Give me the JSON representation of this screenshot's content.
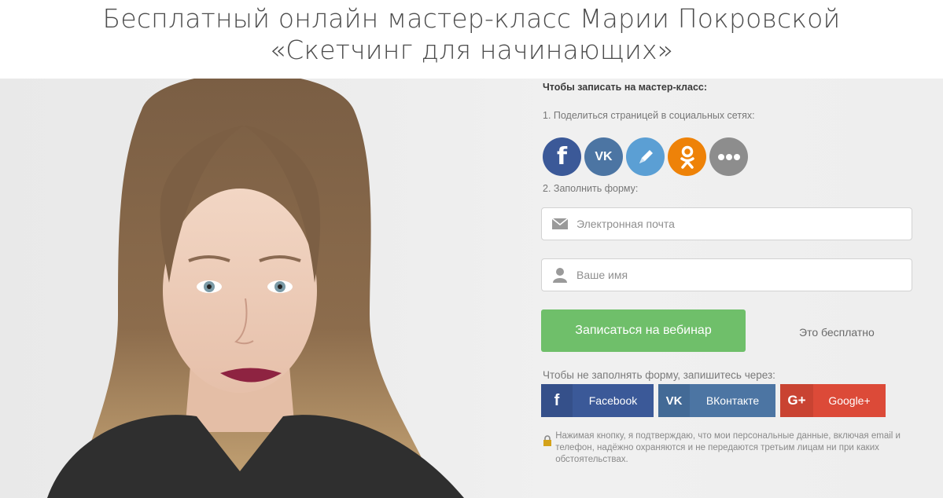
{
  "header": {
    "title_line1": "Бесплатный онлайн мастер-класс Марии Покровской",
    "title_line2": "«Скетчинг для начинающих»"
  },
  "form": {
    "heading": "Чтобы записать на мастер-класс:",
    "step1": "1. Поделиться страницей в социальных сетях:",
    "social_icons": [
      "facebook-icon",
      "vk-icon",
      "livejournal-icon",
      "odnoklassniki-icon",
      "more-icon"
    ],
    "step2": "2. Заполнить форму:",
    "email_placeholder": "Электронная почта",
    "name_placeholder": "Ваше имя",
    "submit_label": "Записаться на вебинар",
    "free_label": "Это бесплатно",
    "alt_signup_text": "Чтобы не заполнять форму, запишитесь через:",
    "facebook_label": "Facebook",
    "vk_label": "ВКонтакте",
    "google_label": "Google+",
    "privacy_text": "Нажимая кнопку, я подтверждаю, что мои персональные данные, включая email и телефон, надёжно охраняются и не передаются третьим лицам ни при каких обстоятельствах."
  },
  "colors": {
    "submit": "#6fbf6a",
    "facebook": "#3b5998",
    "vk": "#4c75a3",
    "google": "#dc4a38",
    "odnoklassniki": "#ee8208"
  }
}
